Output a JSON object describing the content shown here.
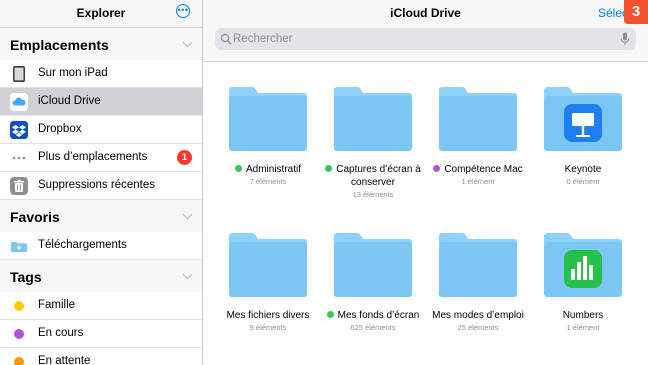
{
  "sidebar": {
    "title": "Explorer",
    "sections": {
      "locations": {
        "heading": "Emplacements",
        "items": [
          {
            "label": "Sur mon iPad",
            "icon": "ipad-icon"
          },
          {
            "label": "iCloud Drive",
            "icon": "icloud-icon",
            "selected": true
          },
          {
            "label": "Dropbox",
            "icon": "dropbox-icon"
          },
          {
            "label": "Plus d’emplacements",
            "icon": "ellipsis-icon",
            "badge": "1"
          },
          {
            "label": "Suppressions récentes",
            "icon": "trash-icon"
          }
        ]
      },
      "favorites": {
        "heading": "Favoris",
        "items": [
          {
            "label": "Téléchargements",
            "icon": "downloads-folder-icon"
          }
        ]
      },
      "tags": {
        "heading": "Tags",
        "items": [
          {
            "label": "Famille",
            "color": "#ffcc00"
          },
          {
            "label": "En cours",
            "color": "#af52de"
          },
          {
            "label": "En attente",
            "color": "#ff9500"
          }
        ]
      }
    }
  },
  "main": {
    "title": "iCloud Drive",
    "select_label": "Sélectionner",
    "step_badge": "3",
    "search": {
      "placeholder": "Rechercher"
    },
    "items": [
      {
        "name": "Administratif",
        "count": "7 éléments",
        "dot": "#34c759"
      },
      {
        "name": "Captures d’écran à conserver",
        "name_line1": "Captures d’écran à",
        "name_line2": "conserver",
        "count": "13 éléments",
        "dot": "#34c759"
      },
      {
        "name": "Compétence Mac",
        "count": "1 élément",
        "dot": "#af52de"
      },
      {
        "name": "Keynote",
        "count": "0 élément",
        "app": "keynote"
      },
      {
        "name": "Mes fichiers divers",
        "count": "9 éléments"
      },
      {
        "name": "Mes fonds d’écran",
        "count": "625 éléments",
        "dot": "#34c759"
      },
      {
        "name": "Mes modes d’emploi",
        "count": "25 éléments"
      },
      {
        "name": "Numbers",
        "count": "1 élément",
        "app": "numbers"
      }
    ]
  },
  "colors": {
    "accent": "#007aff",
    "folder": "#7cc6f3",
    "folder_tab": "#8fd0f6",
    "badge": "#ff3b30"
  }
}
